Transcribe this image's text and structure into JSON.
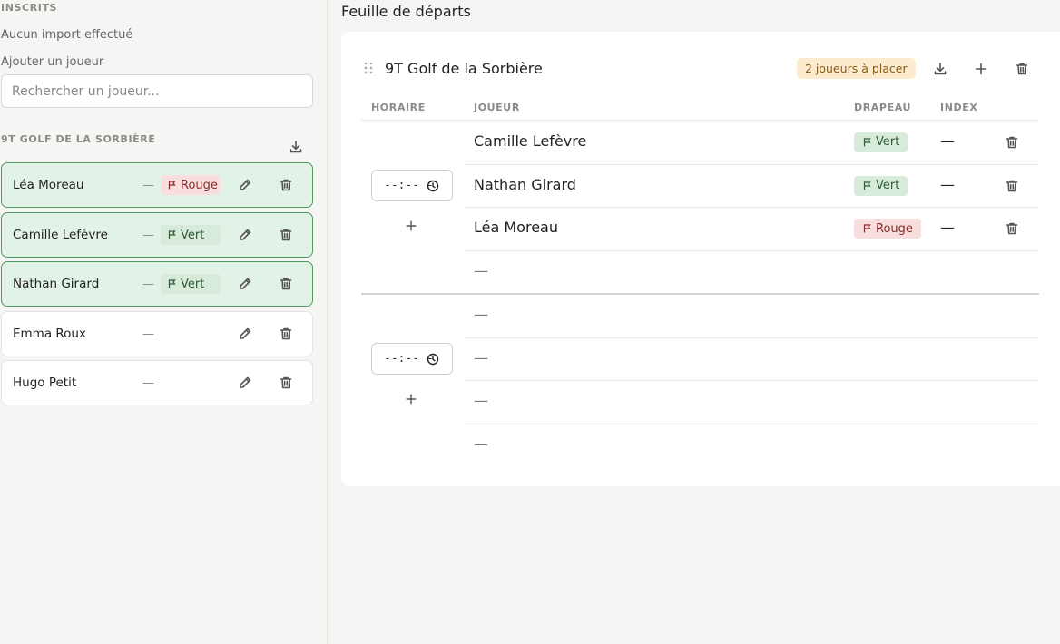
{
  "sidebar": {
    "inscrits_title": "INSCRITS",
    "import_status": "Aucun import effectué",
    "add_player_label": "Ajouter un joueur",
    "search_placeholder": "Rechercher un joueur...",
    "group_title": "9T GOLF DE LA SORBIÈRE",
    "players": [
      {
        "name": "Léa Moreau",
        "index": "—",
        "flag": "Rouge",
        "placed": true
      },
      {
        "name": "Camille Lefèvre",
        "index": "—",
        "flag": "Vert",
        "placed": true
      },
      {
        "name": "Nathan Girard",
        "index": "—",
        "flag": "Vert",
        "placed": true
      },
      {
        "name": "Emma Roux",
        "index": "—",
        "flag": "",
        "placed": false
      },
      {
        "name": "Hugo Petit",
        "index": "—",
        "flag": "",
        "placed": false
      }
    ]
  },
  "main": {
    "title": "Feuille de départs",
    "course_name": "9T Golf de la Sorbière",
    "to_place_badge": "2 joueurs à placer",
    "columns": {
      "horaire": "HORAIRE",
      "joueur": "JOUEUR",
      "drapeau": "DRAPEAU",
      "index": "INDEX"
    },
    "groups": [
      {
        "time": "--:-- -",
        "rows": [
          {
            "player": "Camille Lefèvre",
            "flag": "Vert",
            "index": "—"
          },
          {
            "player": "Nathan Girard",
            "flag": "Vert",
            "index": "—"
          },
          {
            "player": "Léa Moreau",
            "flag": "Rouge",
            "index": "—"
          },
          {
            "player": "—",
            "flag": "",
            "index": ""
          }
        ]
      },
      {
        "time": "--:-- -",
        "rows": [
          {
            "player": "—",
            "flag": "",
            "index": ""
          },
          {
            "player": "—",
            "flag": "",
            "index": ""
          },
          {
            "player": "—",
            "flag": "",
            "index": ""
          },
          {
            "player": "—",
            "flag": "",
            "index": ""
          }
        ]
      }
    ]
  },
  "colors": {
    "placed_bg": "#e2f2e6",
    "placed_border": "#4f9a63",
    "rouge_bg": "#f9dede",
    "vert_bg": "#d8ead9",
    "badge_bg": "#fcebcf"
  },
  "icons": {
    "download": "download-icon",
    "edit": "pencil-icon",
    "delete": "trash-icon",
    "add": "plus-icon",
    "drag": "drag-handle-icon",
    "flag": "flag-icon",
    "clock": "clock-icon"
  }
}
